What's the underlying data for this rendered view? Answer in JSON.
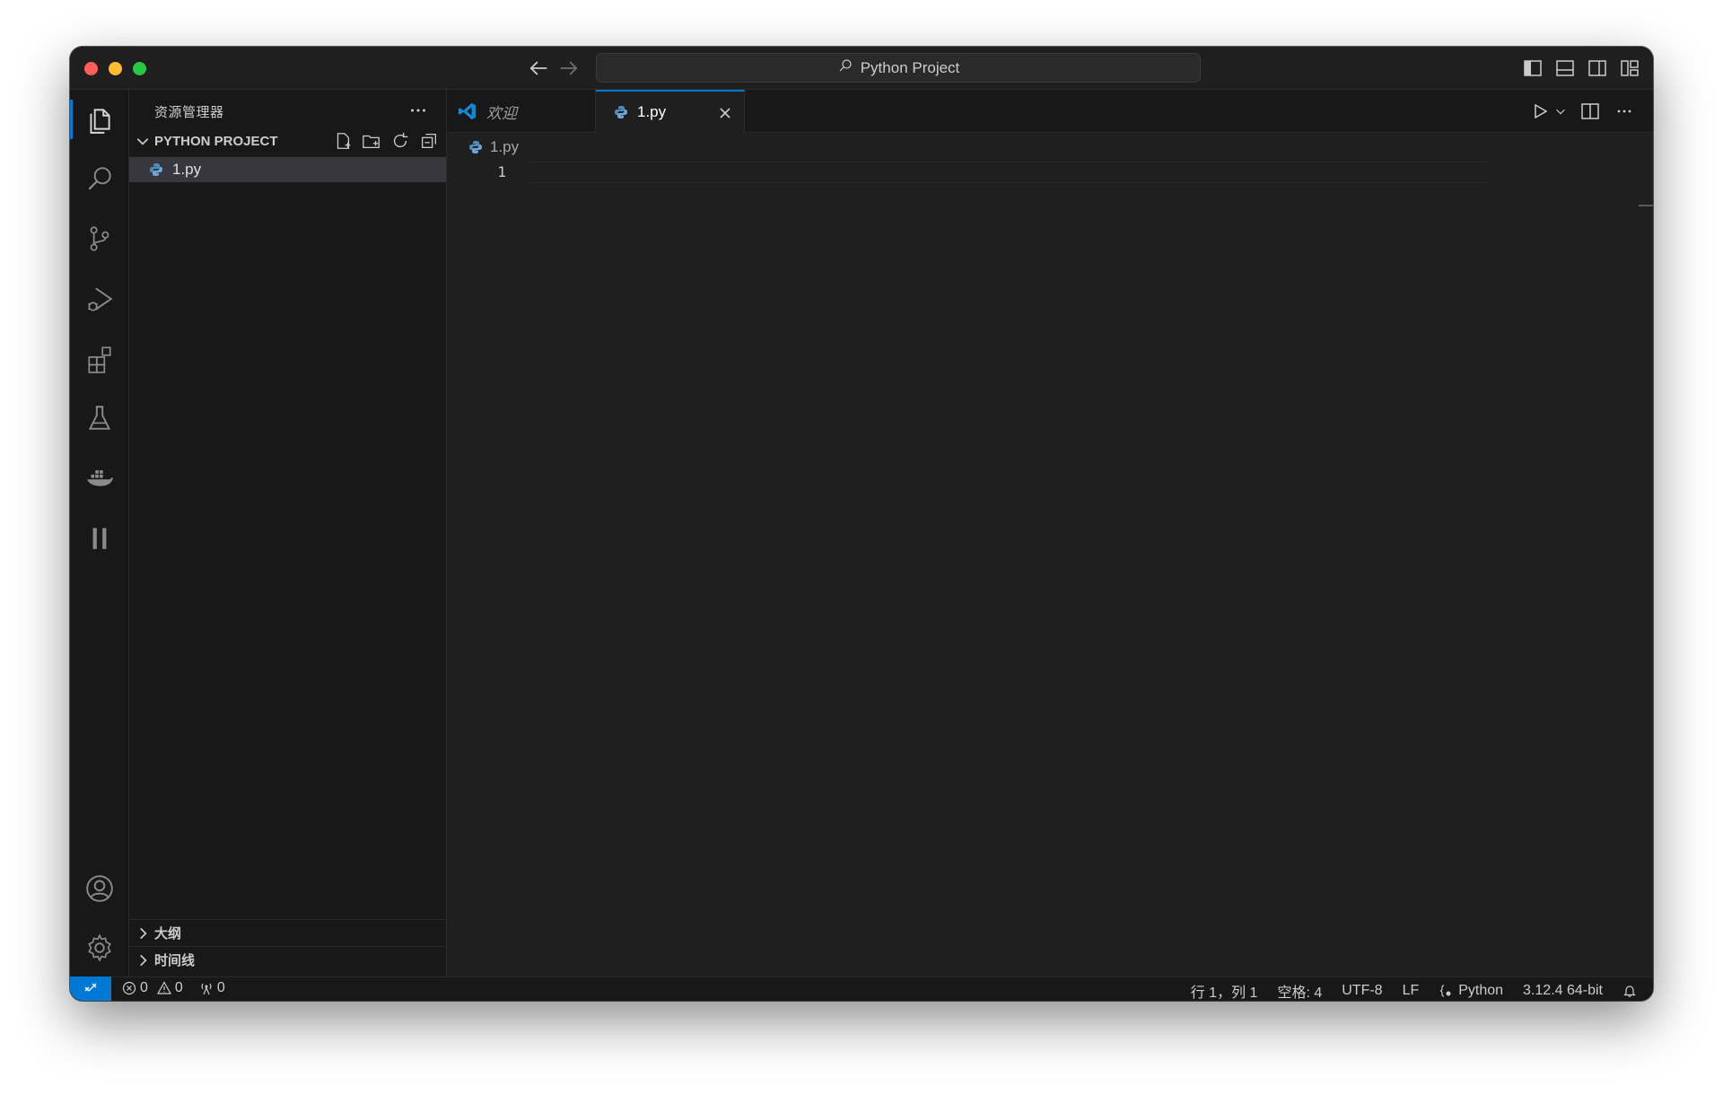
{
  "window": {
    "title_search": "Python Project"
  },
  "sidebar": {
    "title": "资源管理器",
    "section_title": "PYTHON PROJECT",
    "files": [
      {
        "name": "1.py",
        "icon": "python-file-icon",
        "selected": true
      }
    ],
    "outline_label": "大纲",
    "timeline_label": "时间线"
  },
  "activity_bar": {
    "items": [
      "explorer-icon",
      "search-icon",
      "source-control-icon",
      "run-debug-icon",
      "extensions-icon",
      "testing-icon",
      "docker-icon",
      "pause-icon"
    ],
    "bottom_items": [
      "accounts-icon",
      "settings-gear-icon"
    ]
  },
  "editor": {
    "tabs": [
      {
        "label": "欢迎",
        "icon": "vscode-logo-icon",
        "active": false
      },
      {
        "label": "1.py",
        "icon": "python-file-icon",
        "active": true
      }
    ],
    "breadcrumb": "1.py",
    "line_number": "1"
  },
  "status_bar": {
    "errors": "0",
    "warnings": "0",
    "ports": "0",
    "cursor_position": "行 1，列 1",
    "indentation": "空格: 4",
    "encoding": "UTF-8",
    "eol": "LF",
    "language": "Python",
    "interpreter": "3.12.4 64-bit"
  },
  "colors": {
    "accent": "#0078d4",
    "background": "#1f1f1f",
    "sidebar_background": "#181818",
    "selected_row": "#37373d",
    "python_icon": "#4b8bbe"
  }
}
